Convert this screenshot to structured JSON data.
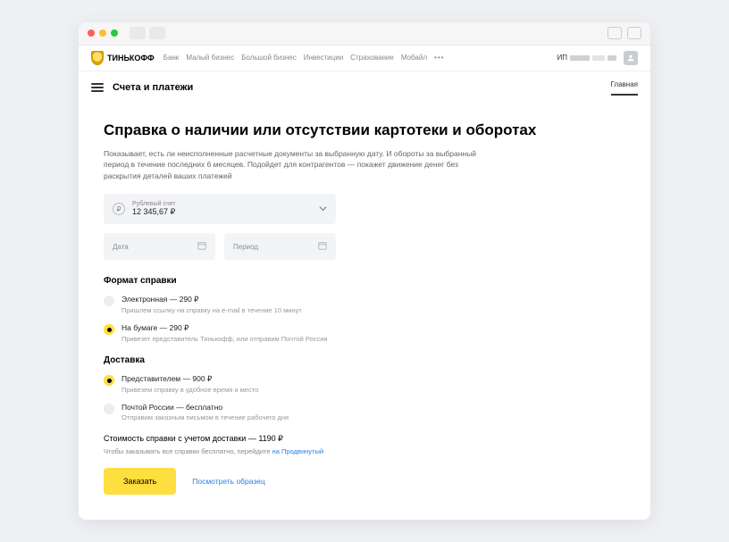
{
  "brand": "ТИНЬКОФФ",
  "nav": {
    "items": [
      "Банк",
      "Малый бизнес",
      "Большой бизнес",
      "Инвестиции",
      "Страхование",
      "Мобайл"
    ],
    "ip_prefix": "ИП"
  },
  "subhead": {
    "title": "Счета и платежи",
    "tab": "Главная"
  },
  "page": {
    "title": "Справка о наличии или отсутствии картотеки и оборотах",
    "desc": "Показывает, есть ли неисполненные расчетные документы за выбранную дату. И обороты за выбранный период в течение последних 6 месяцев. Подойдет для контрагентов — покажет движение денег без раскрытия деталей ваших платежей"
  },
  "account": {
    "label": "Рублевый счет",
    "value": "12 345,67 ₽"
  },
  "date": {
    "placeholder": "Дата"
  },
  "period": {
    "placeholder": "Период"
  },
  "format": {
    "label": "Формат справки",
    "options": [
      {
        "title": "Электронная — 290 ₽",
        "sub": "Пришлем ссылку на справку на e-mail в течение 10 минут",
        "selected": false
      },
      {
        "title": "На бумаге — 290 ₽",
        "sub": "Привезет представитель Тинькофф, или отправим Почтой России",
        "selected": true
      }
    ]
  },
  "delivery": {
    "label": "Доставка",
    "options": [
      {
        "title": "Представителем — 900 ₽",
        "sub": "Привезем справку в удобное время и место",
        "selected": true
      },
      {
        "title": "Почтой России — бесплатно",
        "sub": "Отправим заказным письмом в течение рабочего дня",
        "selected": false
      }
    ]
  },
  "total": {
    "line": "Стоимость справки с учетом доставки — 1190 ₽",
    "upsell_text": "Чтобы заказывать все справки бесплатно, перейдите ",
    "upsell_link": "на Продвинутый"
  },
  "actions": {
    "order": "Заказать",
    "sample": "Посмотреть образец"
  }
}
